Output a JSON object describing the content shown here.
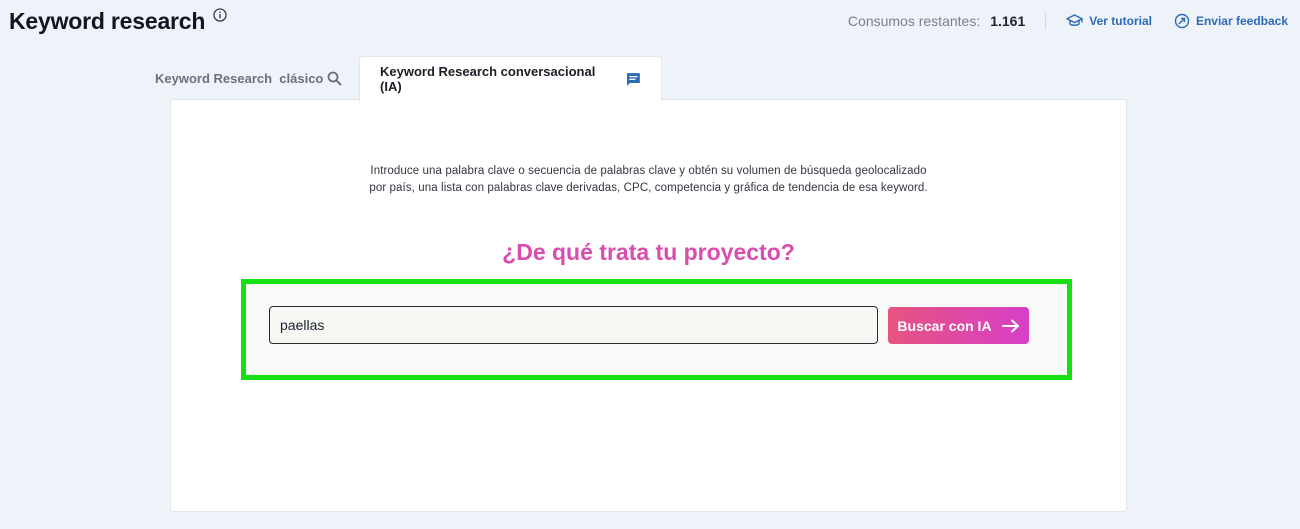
{
  "header": {
    "title": "Keyword research",
    "credits_label": "Consumos restantes:",
    "credits_value": "1.161",
    "tutorial_label": "Ver tutorial",
    "feedback_label": "Enviar feedback"
  },
  "tabs": [
    {
      "label": "Keyword Research  clásico",
      "icon": "search-icon",
      "active": false
    },
    {
      "label": "Keyword Research conversacional (IA)",
      "icon": "chat-icon",
      "active": true
    }
  ],
  "main": {
    "intro_line1": "Introduce una palabra clave o secuencia de palabras clave y obtén su volumen de búsqueda geolocalizado",
    "intro_line2": "por país, una lista con palabras clave derivadas, CPC, competencia y gráfica de tendencia de esa keyword.",
    "question": "¿De qué trata tu proyecto?",
    "search_value": "paellas",
    "button_label": "Buscar con IA"
  },
  "colors": {
    "accent_pink": "#d94cb0",
    "link_blue": "#2d6bb8",
    "highlight_green": "#16e011",
    "button_gradient_start": "#e6537f",
    "button_gradient_end": "#d640c8"
  }
}
